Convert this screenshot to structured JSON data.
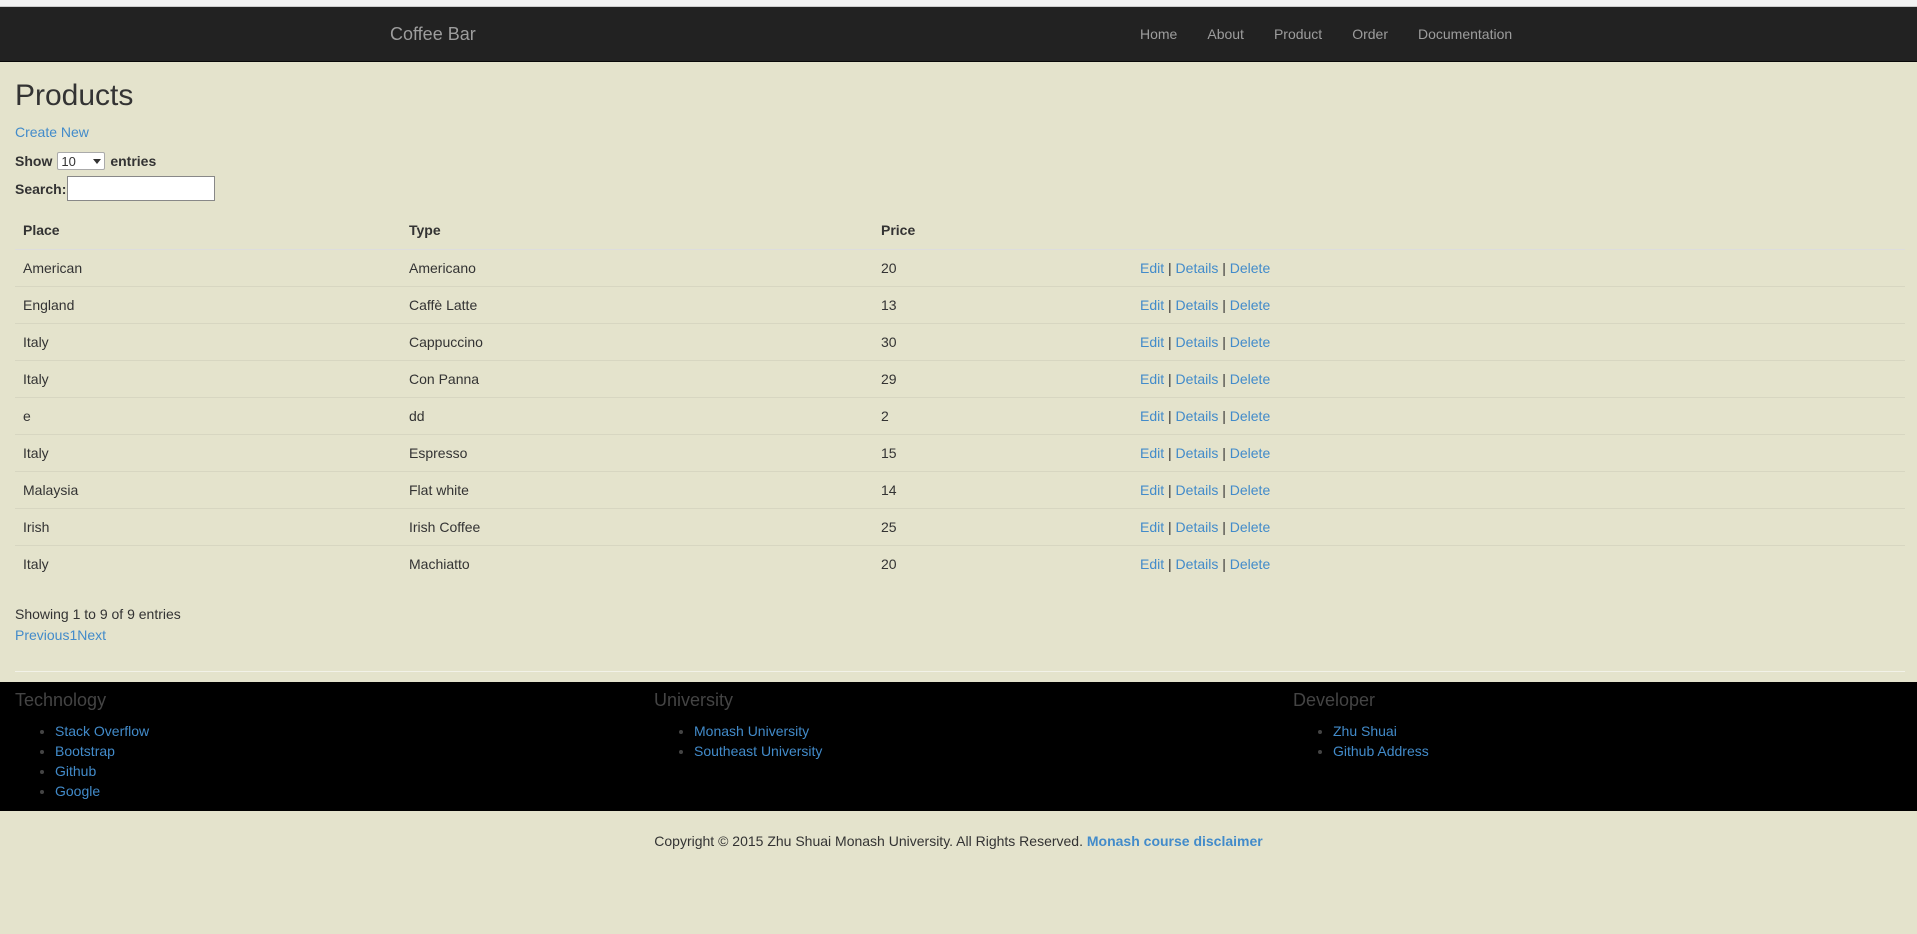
{
  "nav": {
    "brand": "Coffee Bar",
    "links": [
      "Home",
      "About",
      "Product",
      "Order",
      "Documentation"
    ]
  },
  "page": {
    "title": "Products",
    "create_new": "Create New",
    "show_label": "Show",
    "entries_label": "entries",
    "length_value": "10",
    "search_label": "Search:",
    "search_value": ""
  },
  "table": {
    "headers": [
      "Place",
      "Type",
      "Price"
    ],
    "rows": [
      {
        "place": "American",
        "type": "Americano",
        "price": "20"
      },
      {
        "place": "England",
        "type": "Caffè Latte",
        "price": "13"
      },
      {
        "place": "Italy",
        "type": "Cappuccino",
        "price": "30"
      },
      {
        "place": "Italy",
        "type": "Con Panna",
        "price": "29"
      },
      {
        "place": "e",
        "type": "dd",
        "price": "2"
      },
      {
        "place": "Italy",
        "type": "Espresso",
        "price": "15"
      },
      {
        "place": "Malaysia",
        "type": "Flat white",
        "price": "14"
      },
      {
        "place": "Irish",
        "type": "Irish Coffee",
        "price": "25"
      },
      {
        "place": "Italy",
        "type": "Machiatto",
        "price": "20"
      }
    ],
    "actions": {
      "edit": "Edit",
      "details": "Details",
      "delete": "Delete",
      "sep": "|"
    }
  },
  "pagination": {
    "info": "Showing 1 to 9 of 9 entries",
    "previous": "Previous",
    "page": "1",
    "next": "Next"
  },
  "footer": {
    "columns": [
      {
        "title": "Technology",
        "links": [
          "Stack Overflow",
          "Bootstrap",
          "Github",
          "Google"
        ]
      },
      {
        "title": "University",
        "links": [
          "Monash University",
          "Southeast University"
        ]
      },
      {
        "title": "Developer",
        "links": [
          "Zhu Shuai",
          "Github Address"
        ]
      }
    ],
    "copyright": "Copyright © 2015 Zhu Shuai Monash University. All Rights Reserved.",
    "disclaimer": "Monash course disclaimer"
  },
  "colors": {
    "background": "#e4e3cc",
    "navbar": "#222222",
    "link": "#428bca",
    "footer": "#000000"
  }
}
